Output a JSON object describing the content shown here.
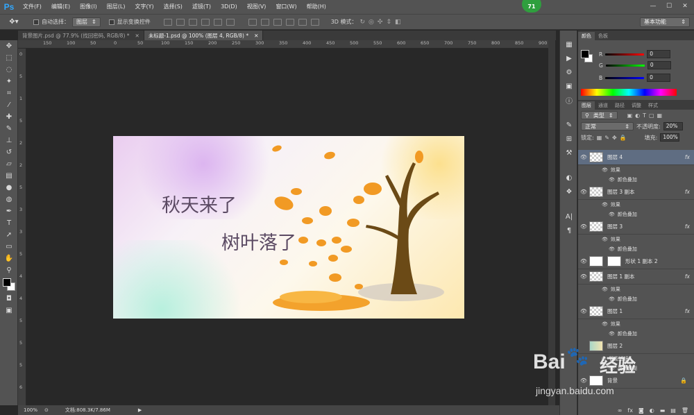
{
  "app": {
    "logo": "Ps",
    "badge": "71"
  },
  "menu": [
    "文件(F)",
    "编辑(E)",
    "图像(I)",
    "图层(L)",
    "文字(Y)",
    "选择(S)",
    "滤镜(T)",
    "3D(D)",
    "视图(V)",
    "窗口(W)",
    "帮助(H)"
  ],
  "options": {
    "auto_select_label": "自动选择：",
    "auto_select_value": "图层",
    "show_transform_label": "显示变换控件",
    "mode3d_label": "3D 模式：",
    "workspace": "基本功能"
  },
  "tabs": [
    {
      "label": "背景图片.psd @ 77.9% (找回密码, RGB/8) *"
    },
    {
      "label": "未标题-1.psd @ 100% (图层 4, RGB/8) *"
    }
  ],
  "ruler_h": [
    "150",
    "100",
    "50",
    "0",
    "50",
    "100",
    "150",
    "200",
    "250",
    "300",
    "350",
    "400",
    "450",
    "500",
    "550",
    "600",
    "650",
    "700",
    "750",
    "800",
    "850",
    "900",
    "950",
    "1000",
    "1050",
    "1100"
  ],
  "ruler_v": [
    "0",
    "5",
    "1",
    "5",
    "2",
    "2",
    "5",
    "3",
    "3",
    "5",
    "4",
    "4",
    "5",
    "5",
    "5",
    "6"
  ],
  "artwork": {
    "line1": "秋天来了",
    "line2": "树叶落了"
  },
  "status": {
    "zoom": "100%",
    "doc": "文档:808.3K/7.86M"
  },
  "color_panel": {
    "tabs": [
      "颜色",
      "色板"
    ],
    "r_label": "R",
    "g_label": "G",
    "b_label": "B",
    "r": "0",
    "g": "0",
    "b": "0"
  },
  "layers_panel": {
    "tabs": [
      "图层",
      "通道",
      "路径",
      "调整",
      "样式"
    ],
    "filter": "类型",
    "blend": "正常",
    "opacity_label": "不透明度:",
    "opacity": "20%",
    "lock_label": "锁定:",
    "fill_label": "填充:",
    "fill": "100%",
    "layers": [
      {
        "name": "图层 4",
        "fx": "fx",
        "effect": "效果",
        "sub": "颜色叠加"
      },
      {
        "name": "图层 3 副本",
        "fx": "fx",
        "effect": "效果",
        "sub": "颜色叠加"
      },
      {
        "name": "图层 3",
        "fx": "fx",
        "effect": "效果",
        "sub": "颜色叠加"
      },
      {
        "name": "形状 1 副本 2"
      },
      {
        "name": "图层 1 副本",
        "fx": "fx",
        "effect": "效果",
        "sub": "颜色叠加"
      },
      {
        "name": "图层 1",
        "fx": "fx",
        "effect": "效果",
        "sub": "颜色叠加"
      },
      {
        "name": "图层 2",
        "effect": "智能滤镜",
        "sub": "高斯模糊"
      },
      {
        "name": "背景"
      }
    ]
  },
  "watermark": {
    "brand": "Bai",
    "brand2": "经验",
    "url": "jingyan.baidu.com"
  },
  "colors": {
    "accent": "#31a8ff",
    "ui": "#535353",
    "canvas_bg": "#282828",
    "text_art": "#5b4a63"
  }
}
